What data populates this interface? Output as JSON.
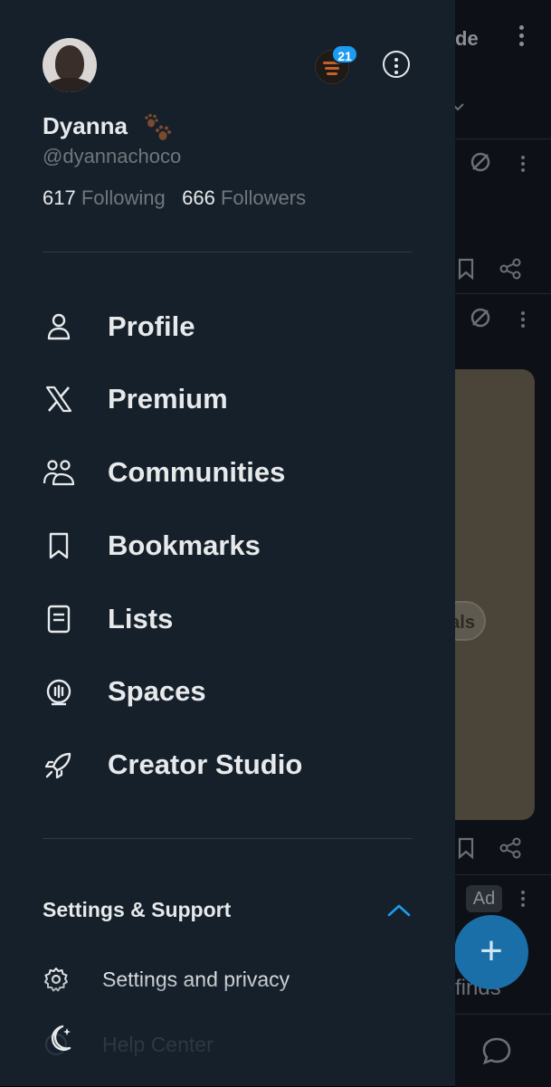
{
  "feed": {
    "header_fragment": "de",
    "pill_fragment": "als",
    "ad_badge": "Ad",
    "text_fragment": "finds",
    "compose_symbol": "+"
  },
  "drawer": {
    "profile": {
      "display_name": "Dyanna",
      "handle": "@dyannachoco",
      "following_count": "617",
      "following_label": "Following",
      "followers_count": "666",
      "followers_label": "Followers"
    },
    "account_switcher": {
      "notification_count": "21"
    },
    "menu": [
      {
        "label": "Profile",
        "icon": "person-icon"
      },
      {
        "label": "Premium",
        "icon": "x-logo-icon"
      },
      {
        "label": "Communities",
        "icon": "communities-icon"
      },
      {
        "label": "Bookmarks",
        "icon": "bookmark-icon"
      },
      {
        "label": "Lists",
        "icon": "list-icon"
      },
      {
        "label": "Spaces",
        "icon": "spaces-icon"
      },
      {
        "label": "Creator Studio",
        "icon": "rocket-icon"
      }
    ],
    "settings_support": {
      "header": "Settings & Support",
      "expanded": true,
      "items": [
        {
          "label": "Settings and privacy",
          "icon": "gear-icon"
        },
        {
          "label": "Help Center",
          "icon": "help-icon"
        }
      ]
    },
    "theme_toggle_icon": "moon-icon"
  },
  "colors": {
    "drawer_bg": "#15202b",
    "text_primary": "#e7e9ea",
    "text_secondary": "#71767b",
    "accent": "#1d9bf0"
  }
}
